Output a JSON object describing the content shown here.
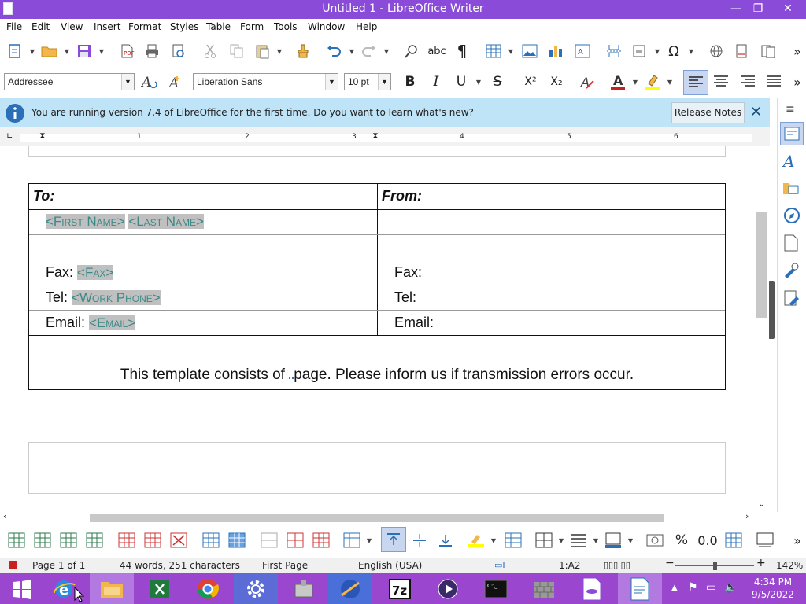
{
  "window": {
    "title": "Untitled 1 - LibreOffice Writer",
    "minimize": "—",
    "restore": "❐",
    "close": "✕"
  },
  "menu": [
    "File",
    "Edit",
    "View",
    "Insert",
    "Format",
    "Styles",
    "Table",
    "Form",
    "Tools",
    "Window",
    "Help"
  ],
  "format_bar": {
    "paragraph_style": "Addressee",
    "font_name": "Liberation Sans",
    "font_size": "10 pt",
    "bold": "B",
    "italic": "I",
    "underline": "U",
    "strike": "S",
    "superscript": "X²",
    "subscript": "X₂"
  },
  "infobar": {
    "message": "You are running version 7.4 of LibreOffice for the first time. Do you want to learn what's new?",
    "button": "Release Notes",
    "close": "✕"
  },
  "ruler": {
    "numbers": [
      "1",
      "2",
      "3",
      "4",
      "5",
      "6"
    ]
  },
  "document": {
    "to_label": "To:",
    "from_label": "From:",
    "first_name": "<First Name>",
    "last_name": "<Last Name>",
    "fax_label": "Fax:",
    "fax_field": "<Fax>",
    "tel_label": "Tel:",
    "tel_field": "<Work Phone>",
    "email_label": "Email:",
    "email_field": "<Email>",
    "from_fax": "Fax:",
    "from_tel": "Tel:",
    "from_email": "Email:",
    "template_before": "This template consists of",
    "template_after": "page. Please inform us if transmission errors occur."
  },
  "statusbar": {
    "page": "Page 1 of 1",
    "words": "44 words, 251 characters",
    "page_style": "First Page",
    "language": "English (USA)",
    "cell": "1:A2",
    "zoom": "142%"
  },
  "taskbar": {
    "time": "4:34 PM",
    "date": "9/5/2022"
  },
  "colors": {
    "titlebar": "#8b4bd9",
    "taskbar": "#9a46cf",
    "infobar": "#bfe3f7",
    "field": "#3a8a88"
  }
}
